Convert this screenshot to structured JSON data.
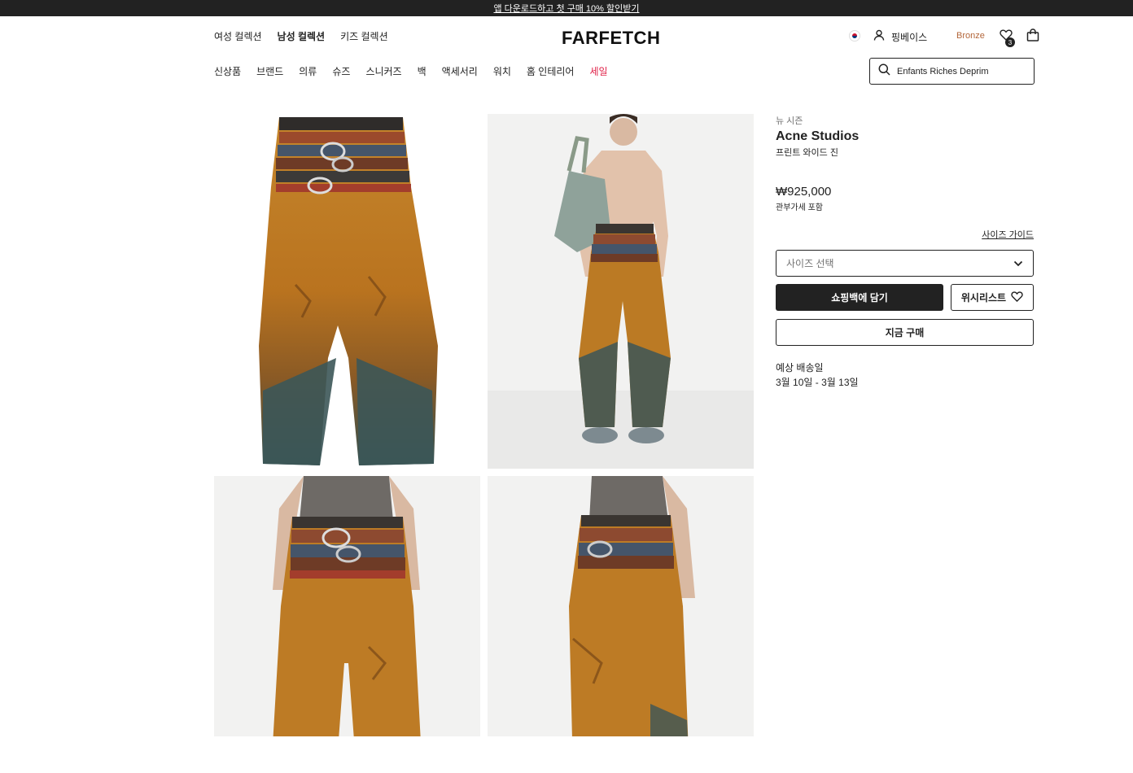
{
  "promo": {
    "text": "앱 다운로드하고 첫 구매 10% 할인받기"
  },
  "header": {
    "gender_tabs": [
      {
        "label": "여성 컬렉션",
        "active": false
      },
      {
        "label": "남성 컬렉션",
        "active": true
      },
      {
        "label": "키즈 컬렉션",
        "active": false
      }
    ],
    "logo": "FARFETCH",
    "account": {
      "flag_icon": "korea-flag-icon",
      "user_name": "핑베이스",
      "tier": "Bronze",
      "wishlist_count": "3"
    }
  },
  "categories": [
    {
      "label": "신상품"
    },
    {
      "label": "브랜드"
    },
    {
      "label": "의류"
    },
    {
      "label": "슈즈"
    },
    {
      "label": "스니커즈"
    },
    {
      "label": "백"
    },
    {
      "label": "액세서리"
    },
    {
      "label": "워치"
    },
    {
      "label": "홈 인테리어"
    },
    {
      "label": "세일"
    }
  ],
  "search": {
    "value": "Enfants Riches Deprim"
  },
  "product": {
    "season": "뉴 시즌",
    "brand": "Acne Studios",
    "name": "프린트 와이드 진",
    "price": "₩925,000",
    "duty_note": "관부가세 포함",
    "size_guide": "사이즈 가이드",
    "size_placeholder": "사이즈 선택",
    "add_to_bag": "쇼핑백에 담기",
    "wishlist": "위시리스트",
    "buy_now": "지금 구매",
    "delivery_label": "예상 배송일",
    "delivery_dates": "3월 10일 - 3월 13일"
  },
  "colors": {
    "sale": "#e0244b",
    "tier": "#b3663a",
    "dark": "#222222"
  }
}
